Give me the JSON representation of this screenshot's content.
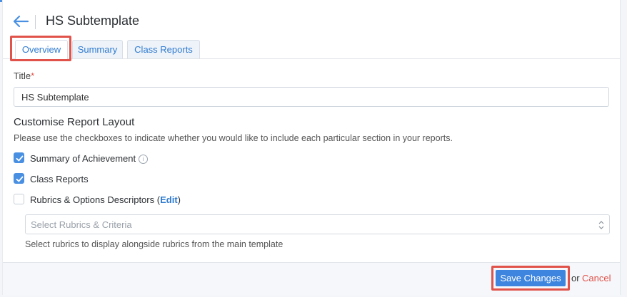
{
  "header": {
    "title": "HS Subtemplate",
    "back_icon": "arrow-left-icon"
  },
  "tabs": [
    {
      "label": "Overview",
      "active": true
    },
    {
      "label": "Summary",
      "active": false
    },
    {
      "label": "Class Reports",
      "active": false
    }
  ],
  "form": {
    "title_label": "Title",
    "required_mark": "*",
    "title_value": "HS Subtemplate",
    "section_title": "Customise Report Layout",
    "help_text": "Please use the checkboxes to indicate whether you would like to include each particular section in your reports.",
    "options": [
      {
        "label": "Summary of Achievement",
        "checked": true
      },
      {
        "label": "Class Reports",
        "checked": true
      },
      {
        "label": "Rubrics & Options Descriptors",
        "checked": false
      }
    ],
    "edit_open": "(",
    "edit_label": "Edit",
    "edit_close": ")",
    "rubrics_placeholder": "Select Rubrics & Criteria",
    "rubrics_hint": "Select rubrics to display alongside rubrics from the main template"
  },
  "footer": {
    "save_label": "Save Changes",
    "or_text": "or",
    "cancel_label": "Cancel"
  },
  "colors": {
    "accent": "#4a90e2",
    "danger": "#e0524a"
  }
}
